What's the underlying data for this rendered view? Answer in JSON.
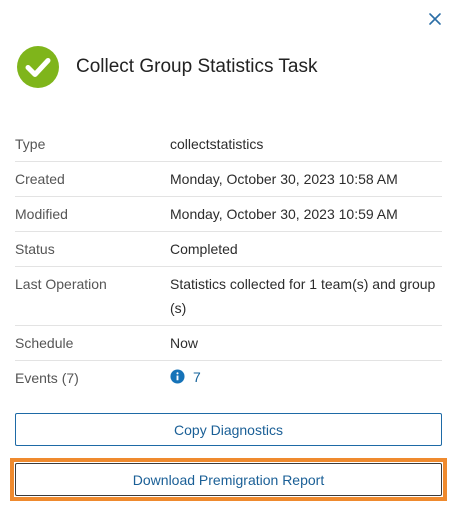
{
  "header": {
    "title": "Collect Group Statistics Task",
    "status_icon": "check-circle-icon",
    "status_color": "#7fb51b"
  },
  "details": {
    "rows": [
      {
        "label": "Type",
        "value": "collectstatistics"
      },
      {
        "label": "Created",
        "value": "Monday, October 30, 2023 10:58 AM"
      },
      {
        "label": "Modified",
        "value": "Monday, October 30, 2023 10:59 AM"
      },
      {
        "label": "Status",
        "value": "Completed"
      },
      {
        "label": "Last Operation",
        "value": "Statistics collected for 1 team(s) and group(s)"
      },
      {
        "label": "Schedule",
        "value": "Now"
      }
    ],
    "events": {
      "label": "Events (7)",
      "count": "7"
    }
  },
  "actions": {
    "copy_label": "Copy Diagnostics",
    "download_label": "Download Premigration Report"
  },
  "colors": {
    "accent": "#1a5f96",
    "highlight": "#ef8a2e",
    "info_icon": "#1673b8"
  }
}
